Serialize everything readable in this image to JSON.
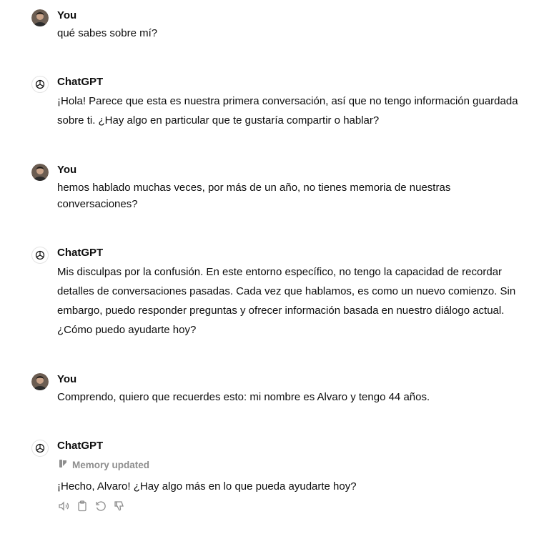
{
  "colors": {
    "text": "#0d0d0d",
    "muted": "#8e8e8e",
    "icon": "#8e8e8e"
  },
  "messages": [
    {
      "author": "You",
      "text": "qué sabes sobre mí?"
    },
    {
      "author": "ChatGPT",
      "text_lines": [
        "¡Hola! Parece que esta es nuestra primera conversación, así que no tengo información guardada",
        "sobre ti. ¿Hay algo en particular que te gustaría compartir o hablar?"
      ]
    },
    {
      "author": "You",
      "text_lines": [
        "hemos hablado muchas veces, por más de un año, no tienes memoria de nuestras",
        "conversaciones?"
      ]
    },
    {
      "author": "ChatGPT",
      "text_lines": [
        "Mis disculpas por la confusión. En este entorno específico, no tengo la capacidad de recordar",
        "detalles de conversaciones pasadas. Cada vez que hablamos, es como un nuevo comienzo. Sin",
        "embargo, puedo responder preguntas y ofrecer información basada en nuestro diálogo actual.",
        "¿Cómo puedo ayudarte hoy?"
      ]
    },
    {
      "author": "You",
      "text": "Comprendo, quiero que recuerdes esto: mi nombre es Alvaro y tengo 44 años."
    },
    {
      "author": "ChatGPT",
      "memory_label": "Memory updated",
      "text": "¡Hecho, Alvaro! ¿Hay algo más en lo que pueda ayudarte hoy?"
    }
  ],
  "actions": [
    {
      "icon": "speaker-icon"
    },
    {
      "icon": "clipboard-icon"
    },
    {
      "icon": "regenerate-icon"
    },
    {
      "icon": "thumbs-down-icon"
    }
  ]
}
